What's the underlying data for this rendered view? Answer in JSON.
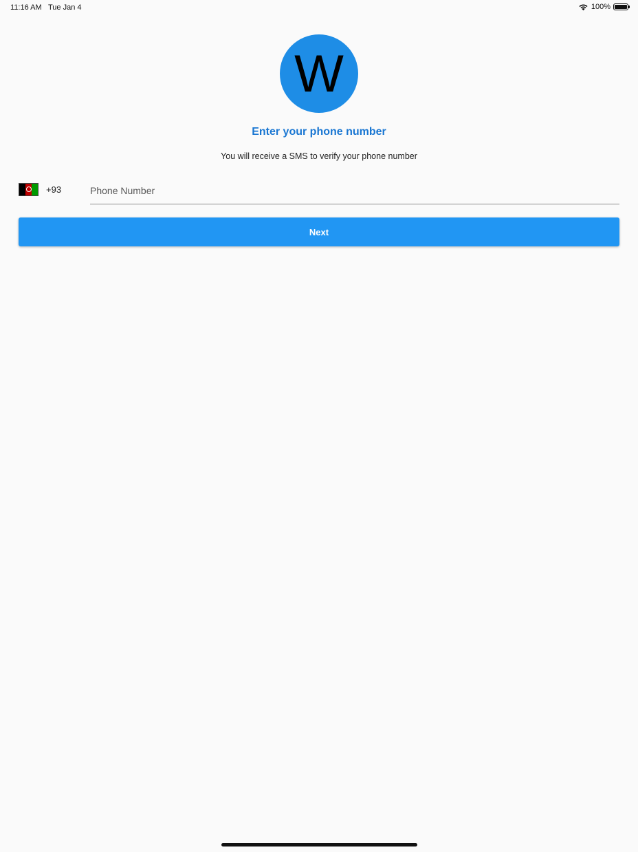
{
  "status_bar": {
    "time": "11:16 AM",
    "date": "Tue Jan 4",
    "battery_percent": "100%",
    "icons": [
      "wifi-icon",
      "battery-icon"
    ]
  },
  "logo": {
    "letter": "W",
    "background_color": "#1e8de6"
  },
  "header": {
    "title": "Enter your phone number",
    "subtitle": "You will receive a SMS to verify your phone number",
    "title_color": "#1976d2"
  },
  "phone_input": {
    "country_flag": "afghanistan-flag-icon",
    "dial_code": "+93",
    "placeholder": "Phone Number",
    "value": ""
  },
  "actions": {
    "next_label": "Next",
    "button_color": "#2196f3"
  }
}
